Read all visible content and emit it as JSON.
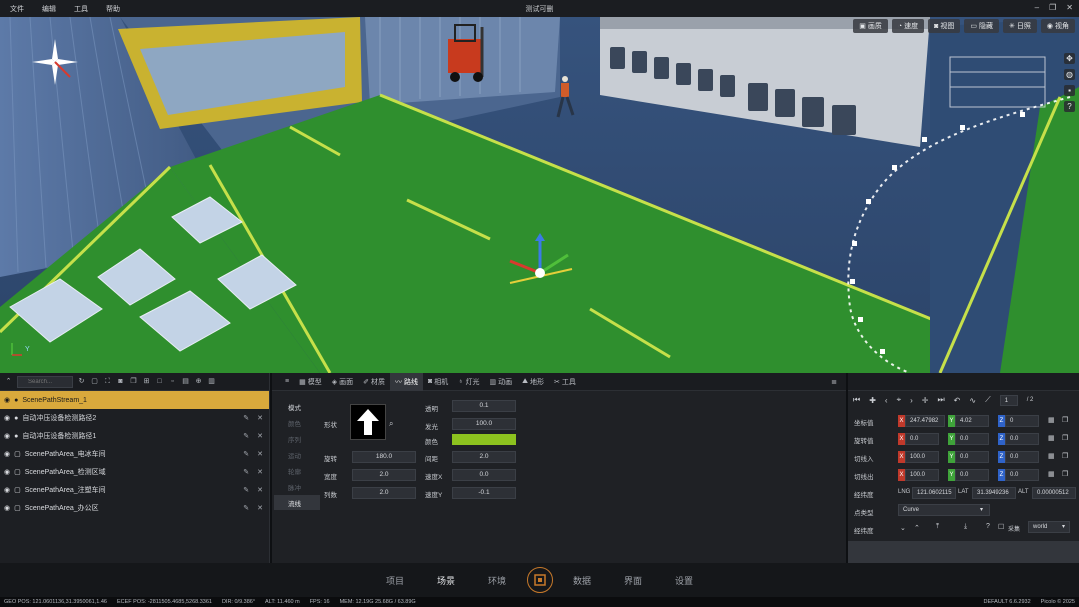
{
  "menu": [
    "文件",
    "编辑",
    "工具",
    "帮助"
  ],
  "window": {
    "title": "测试可删"
  },
  "viewport": {
    "tools": [
      {
        "label": "画质",
        "icon": "image-icon"
      },
      {
        "label": "速度",
        "icon": "speed-icon"
      },
      {
        "label": "视图",
        "icon": "camera-icon"
      },
      {
        "label": "隐藏",
        "icon": "monitor-icon"
      },
      {
        "label": "日照",
        "icon": "sun-icon"
      },
      {
        "label": "视角",
        "icon": "eye-icon"
      }
    ],
    "axis_label": "Y"
  },
  "scene_tree": {
    "search_placeholder": "Search...",
    "items": [
      {
        "label": "ScenePathStream_1",
        "type": "stream",
        "selected": true
      },
      {
        "label": "自动冲压设备检测路径2",
        "type": "path"
      },
      {
        "label": "自动冲压设备检测路径1",
        "type": "path"
      },
      {
        "label": "ScenePathArea_电冰车间",
        "type": "area"
      },
      {
        "label": "ScenePathArea_检测区域",
        "type": "area"
      },
      {
        "label": "ScenePathArea_注塑车间",
        "type": "area"
      },
      {
        "label": "ScenePathArea_办公区",
        "type": "area"
      }
    ]
  },
  "center": {
    "tabs": [
      {
        "label": "模型",
        "icon": "cube-icon"
      },
      {
        "label": "画面",
        "icon": "layers-icon"
      },
      {
        "label": "材质",
        "icon": "brush-icon"
      },
      {
        "label": "路线",
        "icon": "route-icon",
        "active": true
      },
      {
        "label": "相机",
        "icon": "camera-icon"
      },
      {
        "label": "灯光",
        "icon": "bulb-icon"
      },
      {
        "label": "动画",
        "icon": "film-icon"
      },
      {
        "label": "地形",
        "icon": "mountain-icon"
      },
      {
        "label": "工具",
        "icon": "wrench-icon"
      }
    ],
    "side_items": [
      {
        "label": "模式",
        "state": "on"
      },
      {
        "label": "颜色",
        "state": "off"
      },
      {
        "label": "序列",
        "state": "off"
      },
      {
        "label": "运动",
        "state": "off"
      },
      {
        "label": "轮廓",
        "state": "off"
      },
      {
        "label": "脉冲",
        "state": "off"
      },
      {
        "label": "流线",
        "state": "sel"
      }
    ],
    "shape_label": "形状",
    "props_left": [
      {
        "label": "旋转",
        "value": "180.0"
      },
      {
        "label": "宽度",
        "value": "2.0"
      },
      {
        "label": "列数",
        "value": "2.0"
      }
    ],
    "props_right": [
      {
        "label": "透明",
        "value": "0.1"
      },
      {
        "label": "发光",
        "value": "100.0"
      },
      {
        "label": "颜色",
        "value": ""
      },
      {
        "label": "间距",
        "value": "2.0"
      },
      {
        "label": "速度X",
        "value": "0.0"
      },
      {
        "label": "速度Y",
        "value": "-0.1"
      }
    ],
    "color_swatch": "#8dc21f"
  },
  "transform": {
    "page": "1",
    "page_total": "/ 2",
    "rows": [
      {
        "label": "坐标值",
        "x": "247.47982",
        "y": "4.02",
        "z": "0"
      },
      {
        "label": "旋转值",
        "x": "0.0",
        "y": "0.0",
        "z": "0.0"
      },
      {
        "label": "切线入",
        "x": "100.0",
        "y": "0.0",
        "z": "0.0"
      },
      {
        "label": "切线出",
        "x": "100.0",
        "y": "0.0",
        "z": "0.0"
      }
    ],
    "geo_label": "经纬度",
    "lng_label": "LNG",
    "lng": "121.0602115",
    "lat_label": "LAT",
    "lat": "31.3949236",
    "alt_label": "ALT",
    "alt": "0.00000512",
    "point_type_label": "点类型",
    "point_type": "Curve",
    "path_label": "经纬度",
    "snap_label": "采集",
    "world": "world"
  },
  "nav": [
    "项目",
    "场景",
    "环境",
    "数据",
    "界面",
    "设置"
  ],
  "nav_active": "场景",
  "status": {
    "geo_pos": "GEO POS: 121.0601136,31.3950061,1.46",
    "ecef_pos": "ECEF POS: -2811505.4685,5268.3361",
    "dir": "DIR: 0/9.386°",
    "alt": "ALT: 11.460 m",
    "fps": "FPS: 16",
    "mem": "MEM: 12.19G  25.68G / 63.89G",
    "default": "DEFAULT  6.6.2932",
    "copyright": "Picolo © 2025"
  },
  "colors": {
    "accent": "#d9a93c",
    "route_green": "#2f8f2e",
    "logo": "#c7792a"
  }
}
